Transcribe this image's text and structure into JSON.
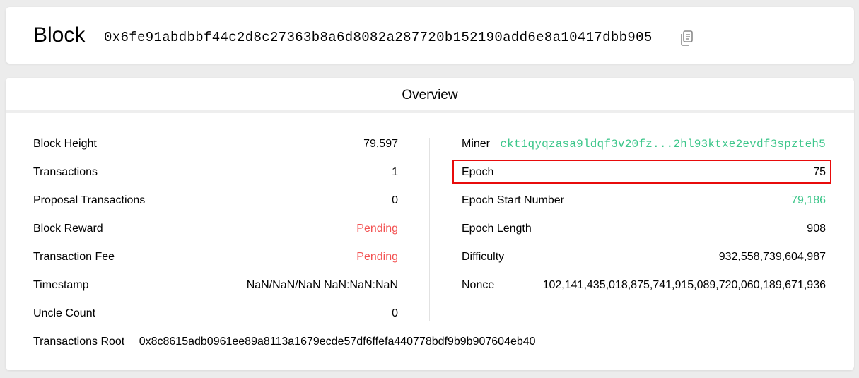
{
  "header": {
    "title": "Block",
    "hash": "0x6fe91abdbbf44c2d8c27363b8a6d8082a287720b152190add6e8a10417dbb905",
    "copy_icon": "copy-icon"
  },
  "overview": {
    "title": "Overview",
    "left": [
      {
        "label": "Block Height",
        "value": "79,597"
      },
      {
        "label": "Transactions",
        "value": "1"
      },
      {
        "label": "Proposal Transactions",
        "value": "0"
      },
      {
        "label": "Block Reward",
        "value": "Pending"
      },
      {
        "label": "Transaction Fee",
        "value": "Pending"
      },
      {
        "label": "Timestamp",
        "value": "NaN/NaN/NaN NaN:NaN:NaN"
      },
      {
        "label": "Uncle Count",
        "value": "0"
      }
    ],
    "right": [
      {
        "label": "Miner",
        "value": "ckt1qyqzasa9ldqf3v20fz...2hl93ktxe2evdf3spzteh5"
      },
      {
        "label": "Epoch",
        "value": "75"
      },
      {
        "label": "Epoch Start Number",
        "value": "79,186"
      },
      {
        "label": "Epoch Length",
        "value": "908"
      },
      {
        "label": "Difficulty",
        "value": "932,558,739,604,987"
      },
      {
        "label": "Nonce",
        "value": "102,141,435,018,875,741,915,089,720,060,189,671,936"
      }
    ],
    "transactions_root": {
      "label": "Transactions Root",
      "value": "0x8c8615adb0961ee89a8113a1679ecde57df6ffefa440778bdf9b9b907604eb40"
    }
  },
  "colors": {
    "pending": "#f35252",
    "link": "#3cc68a",
    "highlight": "#e80b0b"
  }
}
